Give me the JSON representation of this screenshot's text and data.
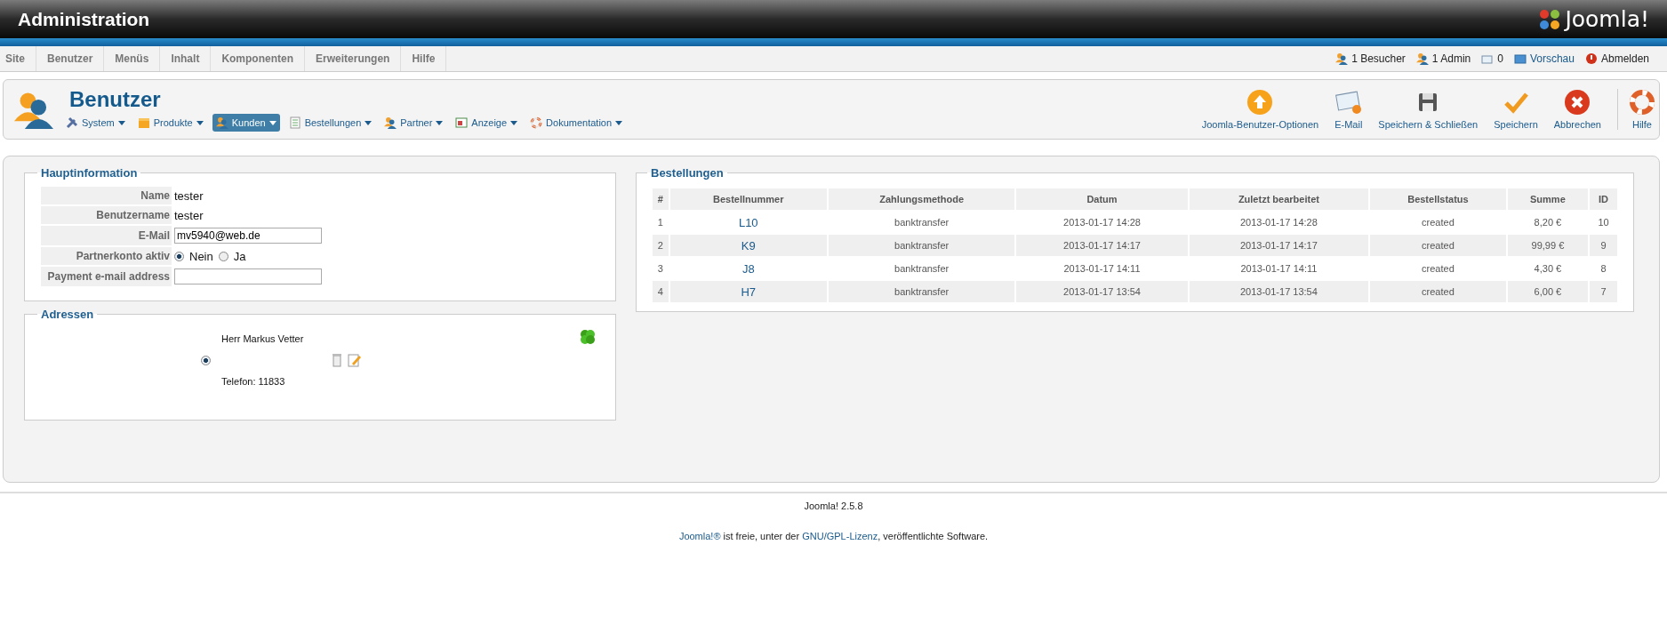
{
  "header": {
    "title": "Administration",
    "logo": "Joomla!"
  },
  "menu": [
    {
      "label": "Site"
    },
    {
      "label": "Benutzer"
    },
    {
      "label": "Menüs"
    },
    {
      "label": "Inhalt"
    },
    {
      "label": "Komponenten"
    },
    {
      "label": "Erweiterungen"
    },
    {
      "label": "Hilfe"
    }
  ],
  "status": [
    {
      "kind": "visitors",
      "label": "1 Besucher"
    },
    {
      "kind": "admins",
      "label": "1 Admin"
    },
    {
      "kind": "messages",
      "label": "0"
    },
    {
      "kind": "preview",
      "label": "Vorschau"
    },
    {
      "kind": "logout",
      "label": "Abmelden"
    }
  ],
  "toolbar": {
    "title": "Benutzer",
    "submenu": [
      {
        "kind": "tools",
        "label": "System",
        "selected": false
      },
      {
        "kind": "box",
        "label": "Produkte",
        "selected": false
      },
      {
        "kind": "user",
        "label": "Kunden",
        "selected": true
      },
      {
        "kind": "list",
        "label": "Bestellungen",
        "selected": false
      },
      {
        "kind": "partner",
        "label": "Partner",
        "selected": false
      },
      {
        "kind": "window",
        "label": "Anzeige",
        "selected": false
      },
      {
        "kind": "lifebuoy",
        "label": "Dokumentation",
        "selected": false
      }
    ],
    "buttons": [
      {
        "kind": "options",
        "label": "Joomla-Benutzer-Optionen"
      },
      {
        "kind": "email",
        "label": "E-Mail"
      },
      {
        "kind": "save-close",
        "label": "Speichern & Schließen"
      },
      {
        "kind": "save",
        "label": "Speichern"
      },
      {
        "kind": "cancel",
        "label": "Abbrechen"
      },
      {
        "kind": "help",
        "label": "Hilfe"
      }
    ]
  },
  "main_info": {
    "legend": "Hauptinformation",
    "fields": [
      {
        "kind": "text",
        "label": "Name",
        "value": "tester"
      },
      {
        "kind": "text",
        "label": "Benutzername",
        "value": "tester"
      },
      {
        "kind": "input",
        "label": "E-Mail",
        "value": "mv5940@web.de"
      },
      {
        "kind": "radio",
        "label": "Partnerkonto aktiv",
        "options": [
          {
            "label": "Nein",
            "selected": true
          },
          {
            "label": "Ja",
            "selected": false
          }
        ]
      },
      {
        "kind": "input",
        "label": "Payment e-mail address"
      }
    ]
  },
  "addresses": {
    "legend": "Adressen",
    "items": [
      {
        "name": "Herr Markus Vetter",
        "phone": "Telefon: 11833",
        "selected": true
      }
    ]
  },
  "orders": {
    "legend": "Bestellungen",
    "columns": [
      "#",
      "Bestellnummer",
      "Zahlungsmethode",
      "Datum",
      "Zuletzt bearbeitet",
      "Bestellstatus",
      "Summe",
      "ID"
    ],
    "rows": [
      [
        "1",
        "L10",
        "banktransfer",
        "2013-01-17 14:28",
        "2013-01-17 14:28",
        "created",
        "8,20 €",
        "10"
      ],
      [
        "2",
        "K9",
        "banktransfer",
        "2013-01-17 14:17",
        "2013-01-17 14:17",
        "created",
        "99,99 €",
        "9"
      ],
      [
        "3",
        "J8",
        "banktransfer",
        "2013-01-17 14:11",
        "2013-01-17 14:11",
        "created",
        "4,30 €",
        "8"
      ],
      [
        "4",
        "H7",
        "banktransfer",
        "2013-01-17 13:54",
        "2013-01-17 13:54",
        "created",
        "6,00 €",
        "7"
      ]
    ]
  },
  "footer": {
    "version": "Joomla! 2.5.8",
    "license": [
      {
        "text": "Joomla!®",
        "link": true
      },
      {
        "text": " ist freie, unter der ",
        "link": false
      },
      {
        "text": "GNU/GPL-Lizenz",
        "link": true
      },
      {
        "text": ", veröffentlichte Software.",
        "link": false
      }
    ]
  }
}
